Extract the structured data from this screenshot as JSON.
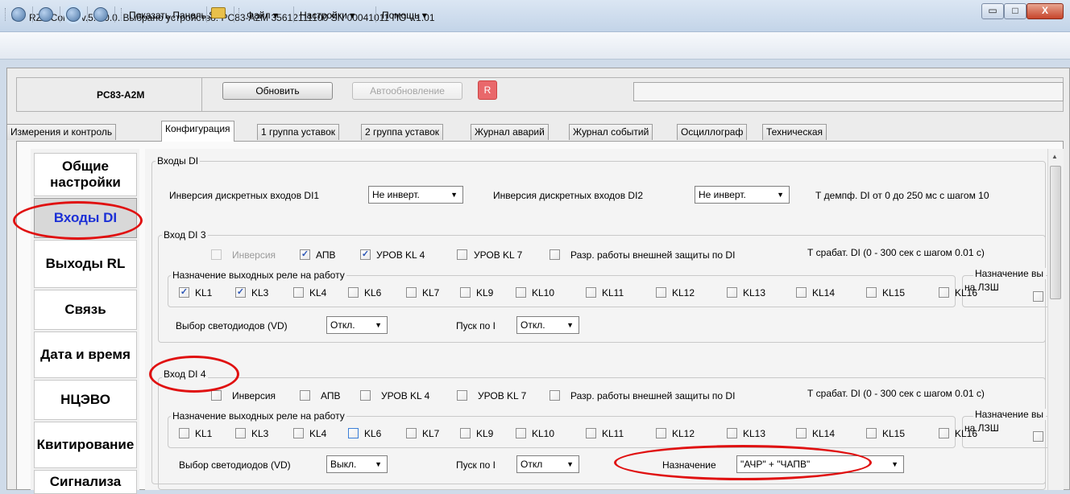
{
  "window": {
    "title": "RZA Config v.5.4.0.0.  Выбрано устройство: PC83-A2M  35612111100  SN 00041011  ПО v.1.01",
    "controls": {
      "minimize": "▭",
      "maximize": "□",
      "close": "X"
    }
  },
  "toolbar": {
    "show_panel": "Показать Панель S",
    "menu_file": "Файл",
    "menu_settings": "Настройки",
    "menu_help": "Помощь",
    "dropdown_glyph": "▾"
  },
  "device_panel": {
    "device_name": "PC83-A2M",
    "refresh": "Обновить",
    "auto_refresh": "Автообновление",
    "r_button": "R"
  },
  "tabs": [
    {
      "label": "Измерения и контроль",
      "active": false
    },
    {
      "label": "Конфигурация",
      "active": true
    },
    {
      "label": "1 группа уставок",
      "active": false
    },
    {
      "label": "2 группа уставок",
      "active": false
    },
    {
      "label": "Журнал аварий",
      "active": false
    },
    {
      "label": "Журнал событий",
      "active": false
    },
    {
      "label": "Осциллограф",
      "active": false
    },
    {
      "label": "Техническая",
      "active": false
    }
  ],
  "nav": [
    {
      "label": "Общие настройки",
      "active": false
    },
    {
      "label": "Входы DI",
      "active": true
    },
    {
      "label": "Выходы RL",
      "active": false
    },
    {
      "label": "Связь",
      "active": false
    },
    {
      "label": "Дата и время",
      "active": false
    },
    {
      "label": "НЦЭВО",
      "active": false
    },
    {
      "label": "Квитирование",
      "active": false
    },
    {
      "label": "Сигнализа",
      "active": false
    }
  ],
  "inputs_di": {
    "title": "Входы DI",
    "inversion1_label": "Инверсия дискретных входов DI1",
    "inversion1_value": "Не инверт.",
    "inversion2_label": "Инверсия дискретных входов DI2",
    "inversion2_value": "Не инверт.",
    "damping_label": "Т демпф. DI от 0 до 250 мс с шагом 10"
  },
  "di3": {
    "title": "Вход DI 3",
    "options": [
      {
        "label": "Инверсия",
        "checked": false,
        "disabled": true
      },
      {
        "label": "АПВ",
        "checked": true
      },
      {
        "label": "УРОВ KL 4",
        "checked": true
      },
      {
        "label": "УРОВ KL 7",
        "checked": false
      },
      {
        "label": "Разр. работы внешней защиты по DI",
        "checked": false
      }
    ],
    "trigger_label": "Т срабат. DI (0 - 300 сек с шагом 0.01 с)",
    "relays_title": "Назначение выходных реле на работу",
    "relays": [
      {
        "label": "KL1",
        "checked": true
      },
      {
        "label": "KL3",
        "checked": true
      },
      {
        "label": "KL4",
        "checked": false
      },
      {
        "label": "KL6",
        "checked": false
      },
      {
        "label": "KL7",
        "checked": false
      },
      {
        "label": "KL9",
        "checked": false
      },
      {
        "label": "KL10",
        "checked": false
      },
      {
        "label": "KL11",
        "checked": false
      },
      {
        "label": "KL12",
        "checked": false
      },
      {
        "label": "KL13",
        "checked": false
      },
      {
        "label": "KL14",
        "checked": false
      },
      {
        "label": "KL15",
        "checked": false
      },
      {
        "label": "KL16",
        "checked": false
      }
    ],
    "assign_title": "Назначение вы",
    "lzsh_label": "на ЛЗШ",
    "leds_label": "Выбор светодиодов (VD)",
    "leds_value": "Откл.",
    "start_label": "Пуск по I",
    "start_value": "Откл."
  },
  "di4": {
    "title": "Вход DI 4",
    "options": [
      {
        "label": "Инверсия",
        "checked": false
      },
      {
        "label": "АПВ",
        "checked": false
      },
      {
        "label": "УРОВ KL 4",
        "checked": false
      },
      {
        "label": "УРОВ KL 7",
        "checked": false
      },
      {
        "label": "Разр. работы внешней защиты по DI",
        "checked": false
      }
    ],
    "trigger_label": "Т срабат. DI (0 - 300 сек с шагом 0.01 с)",
    "relays_title": "Назначение выходных реле на работу",
    "relays": [
      {
        "label": "KL1",
        "checked": false
      },
      {
        "label": "KL3",
        "checked": false
      },
      {
        "label": "KL4",
        "checked": false
      },
      {
        "label": "KL6",
        "checked": false
      },
      {
        "label": "KL7",
        "checked": false
      },
      {
        "label": "KL9",
        "checked": false
      },
      {
        "label": "KL10",
        "checked": false
      },
      {
        "label": "KL11",
        "checked": false
      },
      {
        "label": "KL12",
        "checked": false
      },
      {
        "label": "KL13",
        "checked": false
      },
      {
        "label": "KL14",
        "checked": false
      },
      {
        "label": "KL15",
        "checked": false
      },
      {
        "label": "KL16",
        "checked": false
      }
    ],
    "assign_title": "Назначение вы",
    "lzsh_label": "на ЛЗШ",
    "leds_label": "Выбор светодиодов (VD)",
    "leds_value": "Выкл.",
    "start_label": "Пуск по I",
    "start_value": "Откл",
    "purpose_label": "Назначение",
    "purpose_value": "\"АЧР\" + \"ЧАПВ\""
  },
  "glyphs": {
    "check": "✓",
    "dropdown": "▼"
  }
}
